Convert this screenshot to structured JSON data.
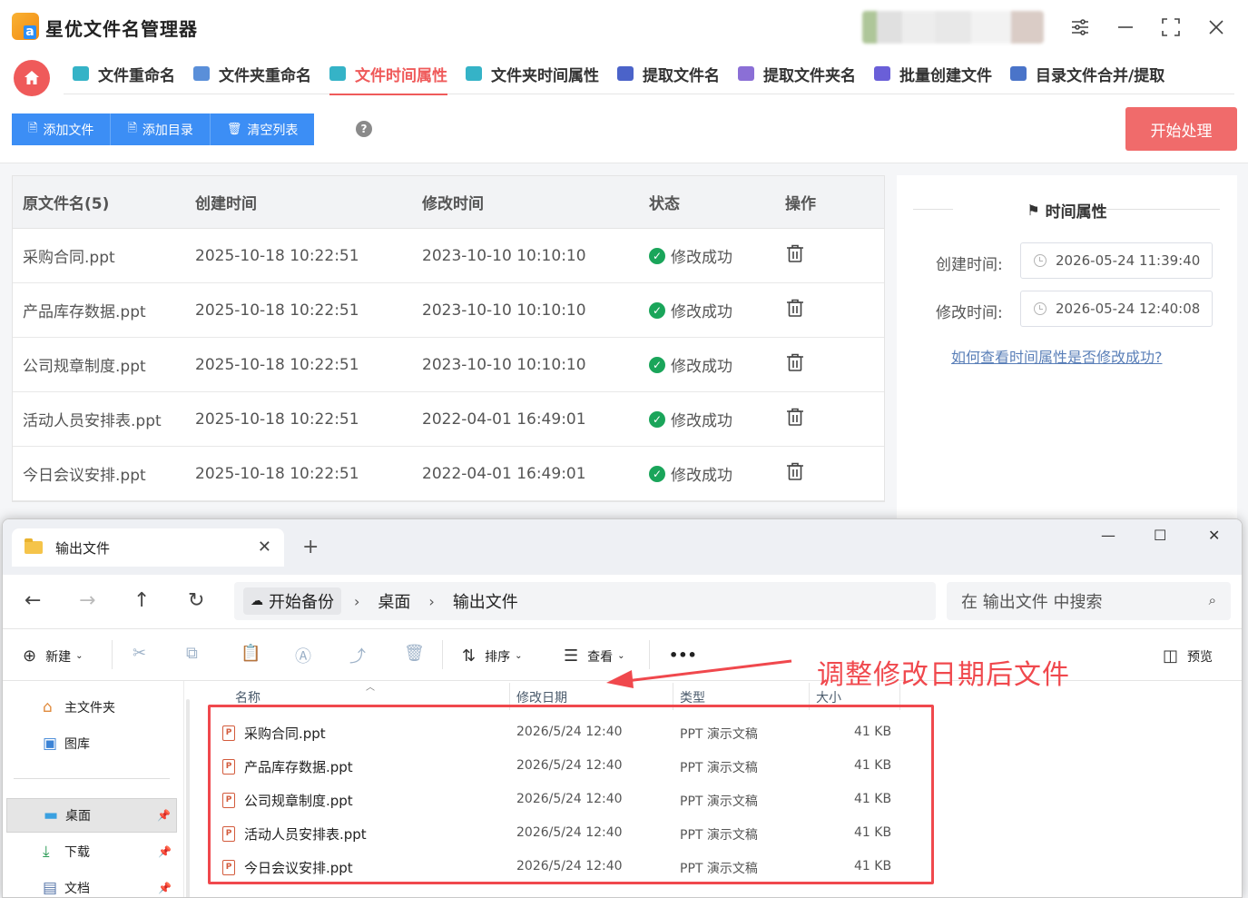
{
  "app": {
    "title": "星优文件名管理器",
    "accent": "#ef5a5a",
    "primary": "#3c8ef5"
  },
  "tabs": [
    {
      "label": "文件重命名",
      "icon": "rename-icon",
      "color": "#35b3c7"
    },
    {
      "label": "文件夹重命名",
      "icon": "folder-rename-icon",
      "color": "#5a8fd9"
    },
    {
      "label": "文件时间属性",
      "icon": "file-time-icon",
      "color": "#35b3c7"
    },
    {
      "label": "文件夹时间属性",
      "icon": "folder-time-icon",
      "color": "#35b3c7"
    },
    {
      "label": "提取文件名",
      "icon": "extract-file-icon",
      "color": "#4b63c9"
    },
    {
      "label": "提取文件夹名",
      "icon": "extract-folder-icon",
      "color": "#8b6fd6"
    },
    {
      "label": "批量创建文件",
      "icon": "batch-create-icon",
      "color": "#6a5fd8"
    },
    {
      "label": "目录文件合并/提取",
      "icon": "merge-icon",
      "color": "#4a74c9"
    }
  ],
  "toolbar": {
    "add_file": "添加文件",
    "add_dir": "添加目录",
    "clear_list": "清空列表",
    "help": "?",
    "start": "开始处理"
  },
  "table": {
    "headers": [
      "原文件名(5)",
      "创建时间",
      "修改时间",
      "状态",
      "操作"
    ],
    "rows": [
      {
        "name": "采购合同.ppt",
        "created": "2025-10-18 10:22:51",
        "modified": "2023-10-10 10:10:10",
        "status": "修改成功"
      },
      {
        "name": "产品库存数据.ppt",
        "created": "2025-10-18 10:22:51",
        "modified": "2023-10-10 10:10:10",
        "status": "修改成功"
      },
      {
        "name": "公司规章制度.ppt",
        "created": "2025-10-18 10:22:51",
        "modified": "2023-10-10 10:10:10",
        "status": "修改成功"
      },
      {
        "name": "活动人员安排表.ppt",
        "created": "2025-10-18 10:22:51",
        "modified": "2022-04-01 16:49:01",
        "status": "修改成功"
      },
      {
        "name": "今日会议安排.ppt",
        "created": "2025-10-18 10:22:51",
        "modified": "2022-04-01 16:49:01",
        "status": "修改成功"
      }
    ]
  },
  "side": {
    "title": "时间属性",
    "created_label": "创建时间:",
    "created_value": "2026-05-24 11:39:40",
    "modified_label": "修改时间:",
    "modified_value": "2026-05-24 12:40:08",
    "help_link": "如何查看时间属性是否修改成功?"
  },
  "explorer": {
    "tab_title": "输出文件",
    "new_tab": "+",
    "breadcrumb": [
      "开始备份",
      "桌面",
      "输出文件"
    ],
    "search_placeholder": "在 输出文件 中搜索",
    "cmd": {
      "new": "新建",
      "sort": "排序",
      "view": "查看",
      "more": "•••",
      "preview": "预览"
    },
    "sidebar": [
      {
        "label": "主文件夹",
        "icon": "home-icon"
      },
      {
        "label": "图库",
        "icon": "gallery-icon"
      },
      {
        "label": "桌面",
        "icon": "desktop-icon",
        "pinned": true,
        "selected": true
      },
      {
        "label": "下载",
        "icon": "download-icon",
        "pinned": true
      },
      {
        "label": "文档",
        "icon": "document-icon",
        "pinned": true
      }
    ],
    "columns": [
      "名称",
      "修改日期",
      "类型",
      "大小"
    ],
    "files": [
      {
        "name": "采购合同.ppt",
        "date": "2026/5/24 12:40",
        "type": "PPT 演示文稿",
        "size": "41 KB"
      },
      {
        "name": "产品库存数据.ppt",
        "date": "2026/5/24 12:40",
        "type": "PPT 演示文稿",
        "size": "41 KB"
      },
      {
        "name": "公司规章制度.ppt",
        "date": "2026/5/24 12:40",
        "type": "PPT 演示文稿",
        "size": "41 KB"
      },
      {
        "name": "活动人员安排表.ppt",
        "date": "2026/5/24 12:40",
        "type": "PPT 演示文稿",
        "size": "41 KB"
      },
      {
        "name": "今日会议安排.ppt",
        "date": "2026/5/24 12:40",
        "type": "PPT 演示文稿",
        "size": "41 KB"
      }
    ]
  },
  "annotation": {
    "text": "调整修改日期后文件",
    "color": "#f0484d"
  }
}
